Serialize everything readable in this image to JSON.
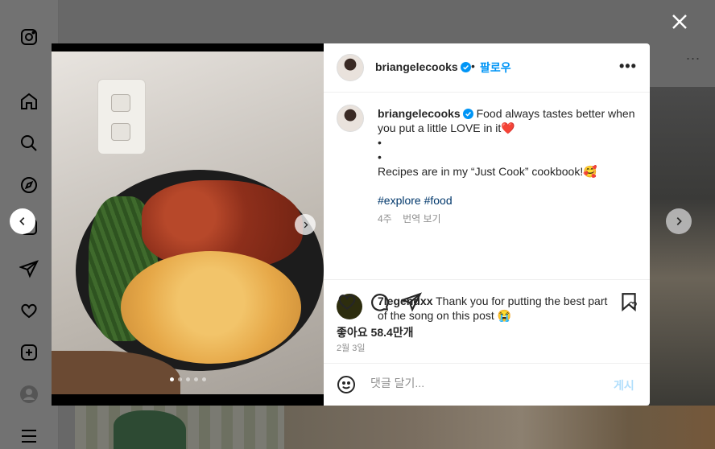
{
  "background": {
    "sidebar_icons": [
      "instagram-icon",
      "home-icon",
      "search-icon",
      "explore-icon",
      "reels-icon",
      "send-icon",
      "heart-icon",
      "create-icon",
      "profile-icon",
      "menu-icon"
    ],
    "more_label": "..."
  },
  "post": {
    "author": "briangelecooks",
    "follow_separator": "•",
    "follow_label": "팔로우",
    "more_label": "•••",
    "caption": {
      "line1": "Food always tastes better when you put a little LOVE in it❤️",
      "bullet1": "•",
      "bullet2": "•",
      "line2": "Recipes are in my “Just Cook” cookbook!🥰",
      "tags": "#explore #food"
    },
    "time_ago": "4주",
    "translate_label": "번역 보기",
    "comments": [
      {
        "user": "7legendxx",
        "text": "Thank you for putting the best part of the song on this post 😭"
      }
    ],
    "likes": "좋아요 58.4만개",
    "date": "2월 3일",
    "comment_placeholder": "댓글 달기...",
    "post_button": "게시",
    "carousel": {
      "count": 5,
      "active_index": 0
    }
  },
  "colors": {
    "accent": "#0095f6",
    "verified": "#0095f6",
    "post_disabled": "#b2dffc"
  }
}
